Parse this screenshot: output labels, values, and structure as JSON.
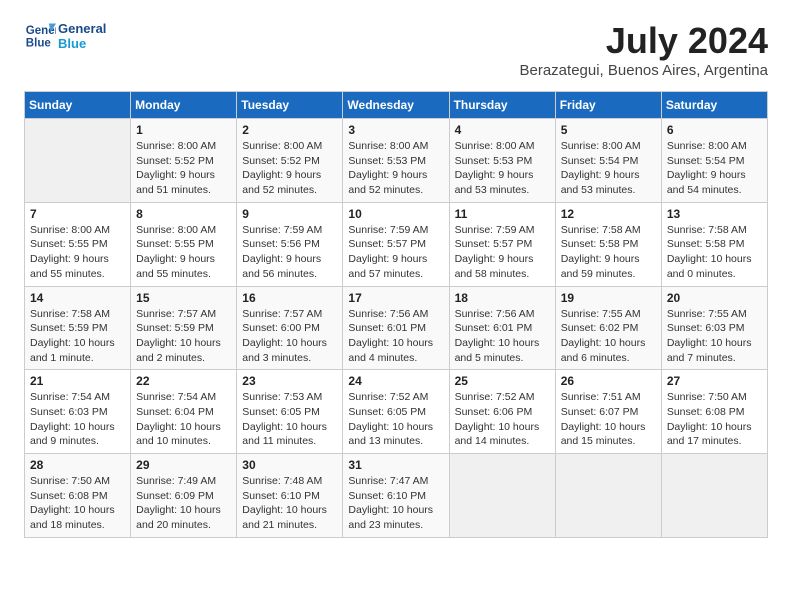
{
  "logo": {
    "line1": "General",
    "line2": "Blue"
  },
  "title": "July 2024",
  "location": "Berazategui, Buenos Aires, Argentina",
  "weekdays": [
    "Sunday",
    "Monday",
    "Tuesday",
    "Wednesday",
    "Thursday",
    "Friday",
    "Saturday"
  ],
  "weeks": [
    [
      {
        "day": "",
        "info": ""
      },
      {
        "day": "1",
        "info": "Sunrise: 8:00 AM\nSunset: 5:52 PM\nDaylight: 9 hours\nand 51 minutes."
      },
      {
        "day": "2",
        "info": "Sunrise: 8:00 AM\nSunset: 5:52 PM\nDaylight: 9 hours\nand 52 minutes."
      },
      {
        "day": "3",
        "info": "Sunrise: 8:00 AM\nSunset: 5:53 PM\nDaylight: 9 hours\nand 52 minutes."
      },
      {
        "day": "4",
        "info": "Sunrise: 8:00 AM\nSunset: 5:53 PM\nDaylight: 9 hours\nand 53 minutes."
      },
      {
        "day": "5",
        "info": "Sunrise: 8:00 AM\nSunset: 5:54 PM\nDaylight: 9 hours\nand 53 minutes."
      },
      {
        "day": "6",
        "info": "Sunrise: 8:00 AM\nSunset: 5:54 PM\nDaylight: 9 hours\nand 54 minutes."
      }
    ],
    [
      {
        "day": "7",
        "info": "Sunrise: 8:00 AM\nSunset: 5:55 PM\nDaylight: 9 hours\nand 55 minutes."
      },
      {
        "day": "8",
        "info": "Sunrise: 8:00 AM\nSunset: 5:55 PM\nDaylight: 9 hours\nand 55 minutes."
      },
      {
        "day": "9",
        "info": "Sunrise: 7:59 AM\nSunset: 5:56 PM\nDaylight: 9 hours\nand 56 minutes."
      },
      {
        "day": "10",
        "info": "Sunrise: 7:59 AM\nSunset: 5:57 PM\nDaylight: 9 hours\nand 57 minutes."
      },
      {
        "day": "11",
        "info": "Sunrise: 7:59 AM\nSunset: 5:57 PM\nDaylight: 9 hours\nand 58 minutes."
      },
      {
        "day": "12",
        "info": "Sunrise: 7:58 AM\nSunset: 5:58 PM\nDaylight: 9 hours\nand 59 minutes."
      },
      {
        "day": "13",
        "info": "Sunrise: 7:58 AM\nSunset: 5:58 PM\nDaylight: 10 hours\nand 0 minutes."
      }
    ],
    [
      {
        "day": "14",
        "info": "Sunrise: 7:58 AM\nSunset: 5:59 PM\nDaylight: 10 hours\nand 1 minute."
      },
      {
        "day": "15",
        "info": "Sunrise: 7:57 AM\nSunset: 5:59 PM\nDaylight: 10 hours\nand 2 minutes."
      },
      {
        "day": "16",
        "info": "Sunrise: 7:57 AM\nSunset: 6:00 PM\nDaylight: 10 hours\nand 3 minutes."
      },
      {
        "day": "17",
        "info": "Sunrise: 7:56 AM\nSunset: 6:01 PM\nDaylight: 10 hours\nand 4 minutes."
      },
      {
        "day": "18",
        "info": "Sunrise: 7:56 AM\nSunset: 6:01 PM\nDaylight: 10 hours\nand 5 minutes."
      },
      {
        "day": "19",
        "info": "Sunrise: 7:55 AM\nSunset: 6:02 PM\nDaylight: 10 hours\nand 6 minutes."
      },
      {
        "day": "20",
        "info": "Sunrise: 7:55 AM\nSunset: 6:03 PM\nDaylight: 10 hours\nand 7 minutes."
      }
    ],
    [
      {
        "day": "21",
        "info": "Sunrise: 7:54 AM\nSunset: 6:03 PM\nDaylight: 10 hours\nand 9 minutes."
      },
      {
        "day": "22",
        "info": "Sunrise: 7:54 AM\nSunset: 6:04 PM\nDaylight: 10 hours\nand 10 minutes."
      },
      {
        "day": "23",
        "info": "Sunrise: 7:53 AM\nSunset: 6:05 PM\nDaylight: 10 hours\nand 11 minutes."
      },
      {
        "day": "24",
        "info": "Sunrise: 7:52 AM\nSunset: 6:05 PM\nDaylight: 10 hours\nand 13 minutes."
      },
      {
        "day": "25",
        "info": "Sunrise: 7:52 AM\nSunset: 6:06 PM\nDaylight: 10 hours\nand 14 minutes."
      },
      {
        "day": "26",
        "info": "Sunrise: 7:51 AM\nSunset: 6:07 PM\nDaylight: 10 hours\nand 15 minutes."
      },
      {
        "day": "27",
        "info": "Sunrise: 7:50 AM\nSunset: 6:08 PM\nDaylight: 10 hours\nand 17 minutes."
      }
    ],
    [
      {
        "day": "28",
        "info": "Sunrise: 7:50 AM\nSunset: 6:08 PM\nDaylight: 10 hours\nand 18 minutes."
      },
      {
        "day": "29",
        "info": "Sunrise: 7:49 AM\nSunset: 6:09 PM\nDaylight: 10 hours\nand 20 minutes."
      },
      {
        "day": "30",
        "info": "Sunrise: 7:48 AM\nSunset: 6:10 PM\nDaylight: 10 hours\nand 21 minutes."
      },
      {
        "day": "31",
        "info": "Sunrise: 7:47 AM\nSunset: 6:10 PM\nDaylight: 10 hours\nand 23 minutes."
      },
      {
        "day": "",
        "info": ""
      },
      {
        "day": "",
        "info": ""
      },
      {
        "day": "",
        "info": ""
      }
    ]
  ]
}
